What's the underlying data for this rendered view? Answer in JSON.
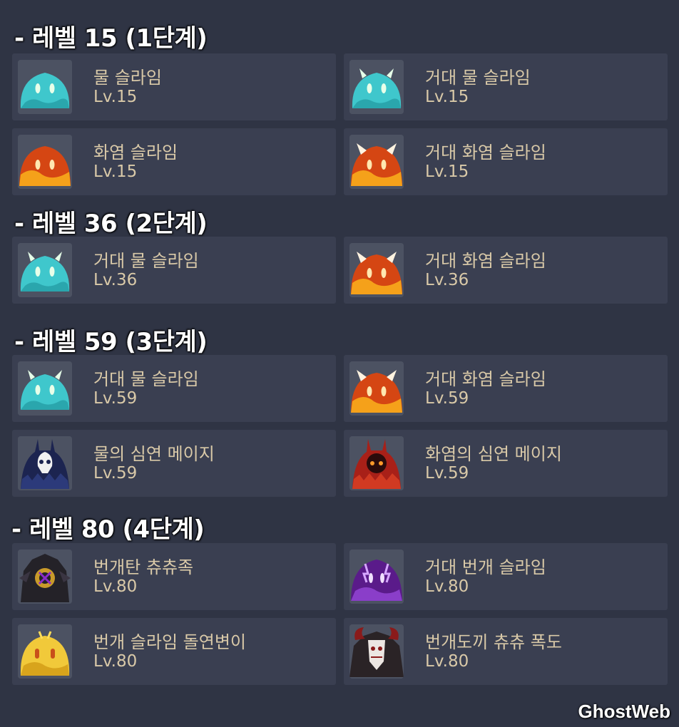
{
  "sections": [
    {
      "title": "- 레벨 15 (1단계)"
    },
    {
      "title": "- 레벨 36 (2단계)"
    },
    {
      "title": "- 레벨 59 (3단계)"
    },
    {
      "title": "- 레벨 80 (4단계)"
    }
  ],
  "enemies": {
    "s1": [
      {
        "name": "물 슬라임",
        "level": "Lv.15",
        "icon": "water-slime-icon"
      },
      {
        "name": "거대 물 슬라임",
        "level": "Lv.15",
        "icon": "large-water-slime-icon"
      },
      {
        "name": "화염 슬라임",
        "level": "Lv.15",
        "icon": "fire-slime-icon"
      },
      {
        "name": "거대 화염 슬라임",
        "level": "Lv.15",
        "icon": "large-fire-slime-icon"
      }
    ],
    "s2": [
      {
        "name": "거대 물 슬라임",
        "level": "Lv.36",
        "icon": "large-water-slime-icon"
      },
      {
        "name": "거대 화염 슬라임",
        "level": "Lv.36",
        "icon": "large-fire-slime-icon"
      }
    ],
    "s3": [
      {
        "name": "거대 물 슬라임",
        "level": "Lv.59",
        "icon": "large-water-slime-icon"
      },
      {
        "name": "거대 화염 슬라임",
        "level": "Lv.59",
        "icon": "large-fire-slime-icon"
      },
      {
        "name": "물의 심연 메이지",
        "level": "Lv.59",
        "icon": "hydro-abyss-mage-icon"
      },
      {
        "name": "화염의 심연 메이지",
        "level": "Lv.59",
        "icon": "pyro-abyss-mage-icon"
      }
    ],
    "s4": [
      {
        "name": "번개탄 츄츄족",
        "level": "Lv.80",
        "icon": "electro-hilichurl-icon"
      },
      {
        "name": "거대 번개 슬라임",
        "level": "Lv.80",
        "icon": "large-electro-slime-icon"
      },
      {
        "name": "번개 슬라임 돌연변이",
        "level": "Lv.80",
        "icon": "mutant-electro-slime-icon"
      },
      {
        "name": "번개도끼 츄츄 폭도",
        "level": "Lv.80",
        "icon": "electro-mitachurl-icon"
      }
    ]
  },
  "watermark": "GhostWeb",
  "colors": {
    "background": "#2f3444",
    "card": "#3a3f51",
    "text": "#d9c9a8"
  }
}
